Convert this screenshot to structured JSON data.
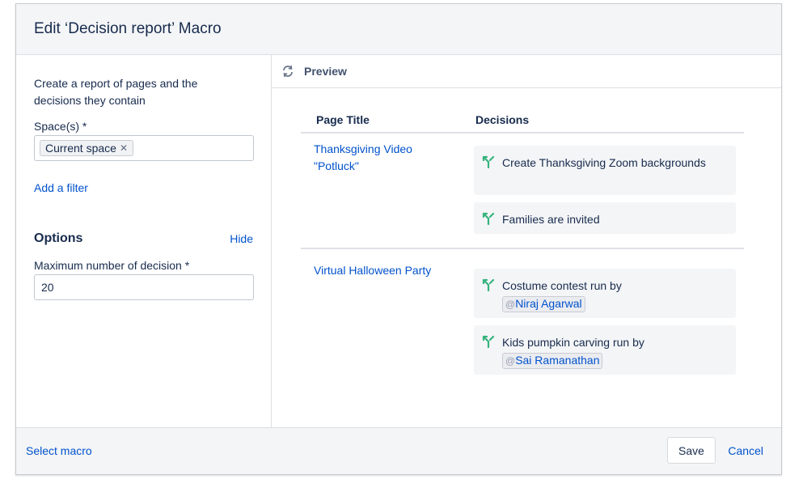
{
  "dialog": {
    "title": "Edit ‘Decision report’ Macro"
  },
  "left_panel": {
    "description": "Create a report of pages and the decisions they contain",
    "spaces_label": "Space(s) *",
    "spaces_chips": [
      {
        "label": "Current space",
        "remove_icon": "close-icon"
      }
    ],
    "add_filter_link": "Add a filter",
    "options_heading": "Options",
    "hide_link": "Hide",
    "max_decisions_label": "Maximum number of decision *",
    "max_decisions_value": "20"
  },
  "preview": {
    "icon": "refresh-icon",
    "label": "Preview",
    "columns": [
      "Page Title",
      "Decisions"
    ],
    "rows": [
      {
        "page_title": "Thanksgiving Video \"Potluck\"",
        "decisions": [
          {
            "icon": "decision-icon",
            "text": "Create Thanksgiving Zoom backgrounds",
            "mention": null
          },
          {
            "icon": "decision-icon",
            "text": "Families are invited",
            "mention": null
          }
        ]
      },
      {
        "page_title": "Virtual Halloween Party",
        "decisions": [
          {
            "icon": "decision-icon",
            "text": "Costume contest run by",
            "mention": {
              "at": "@",
              "name": "Niraj Agarwal"
            }
          },
          {
            "icon": "decision-icon",
            "text": "Kids pumpkin carving run by",
            "mention": {
              "at": "@",
              "name": "Sai Ramanathan"
            }
          }
        ]
      }
    ]
  },
  "footer": {
    "select_macro_link": "Select macro",
    "save_button": "Save",
    "cancel_link": "Cancel"
  },
  "colors": {
    "link": "#0052cc",
    "decision_icon": "#36b37e",
    "card_bg": "#f4f5f7",
    "header_bg": "#f4f5f7"
  }
}
